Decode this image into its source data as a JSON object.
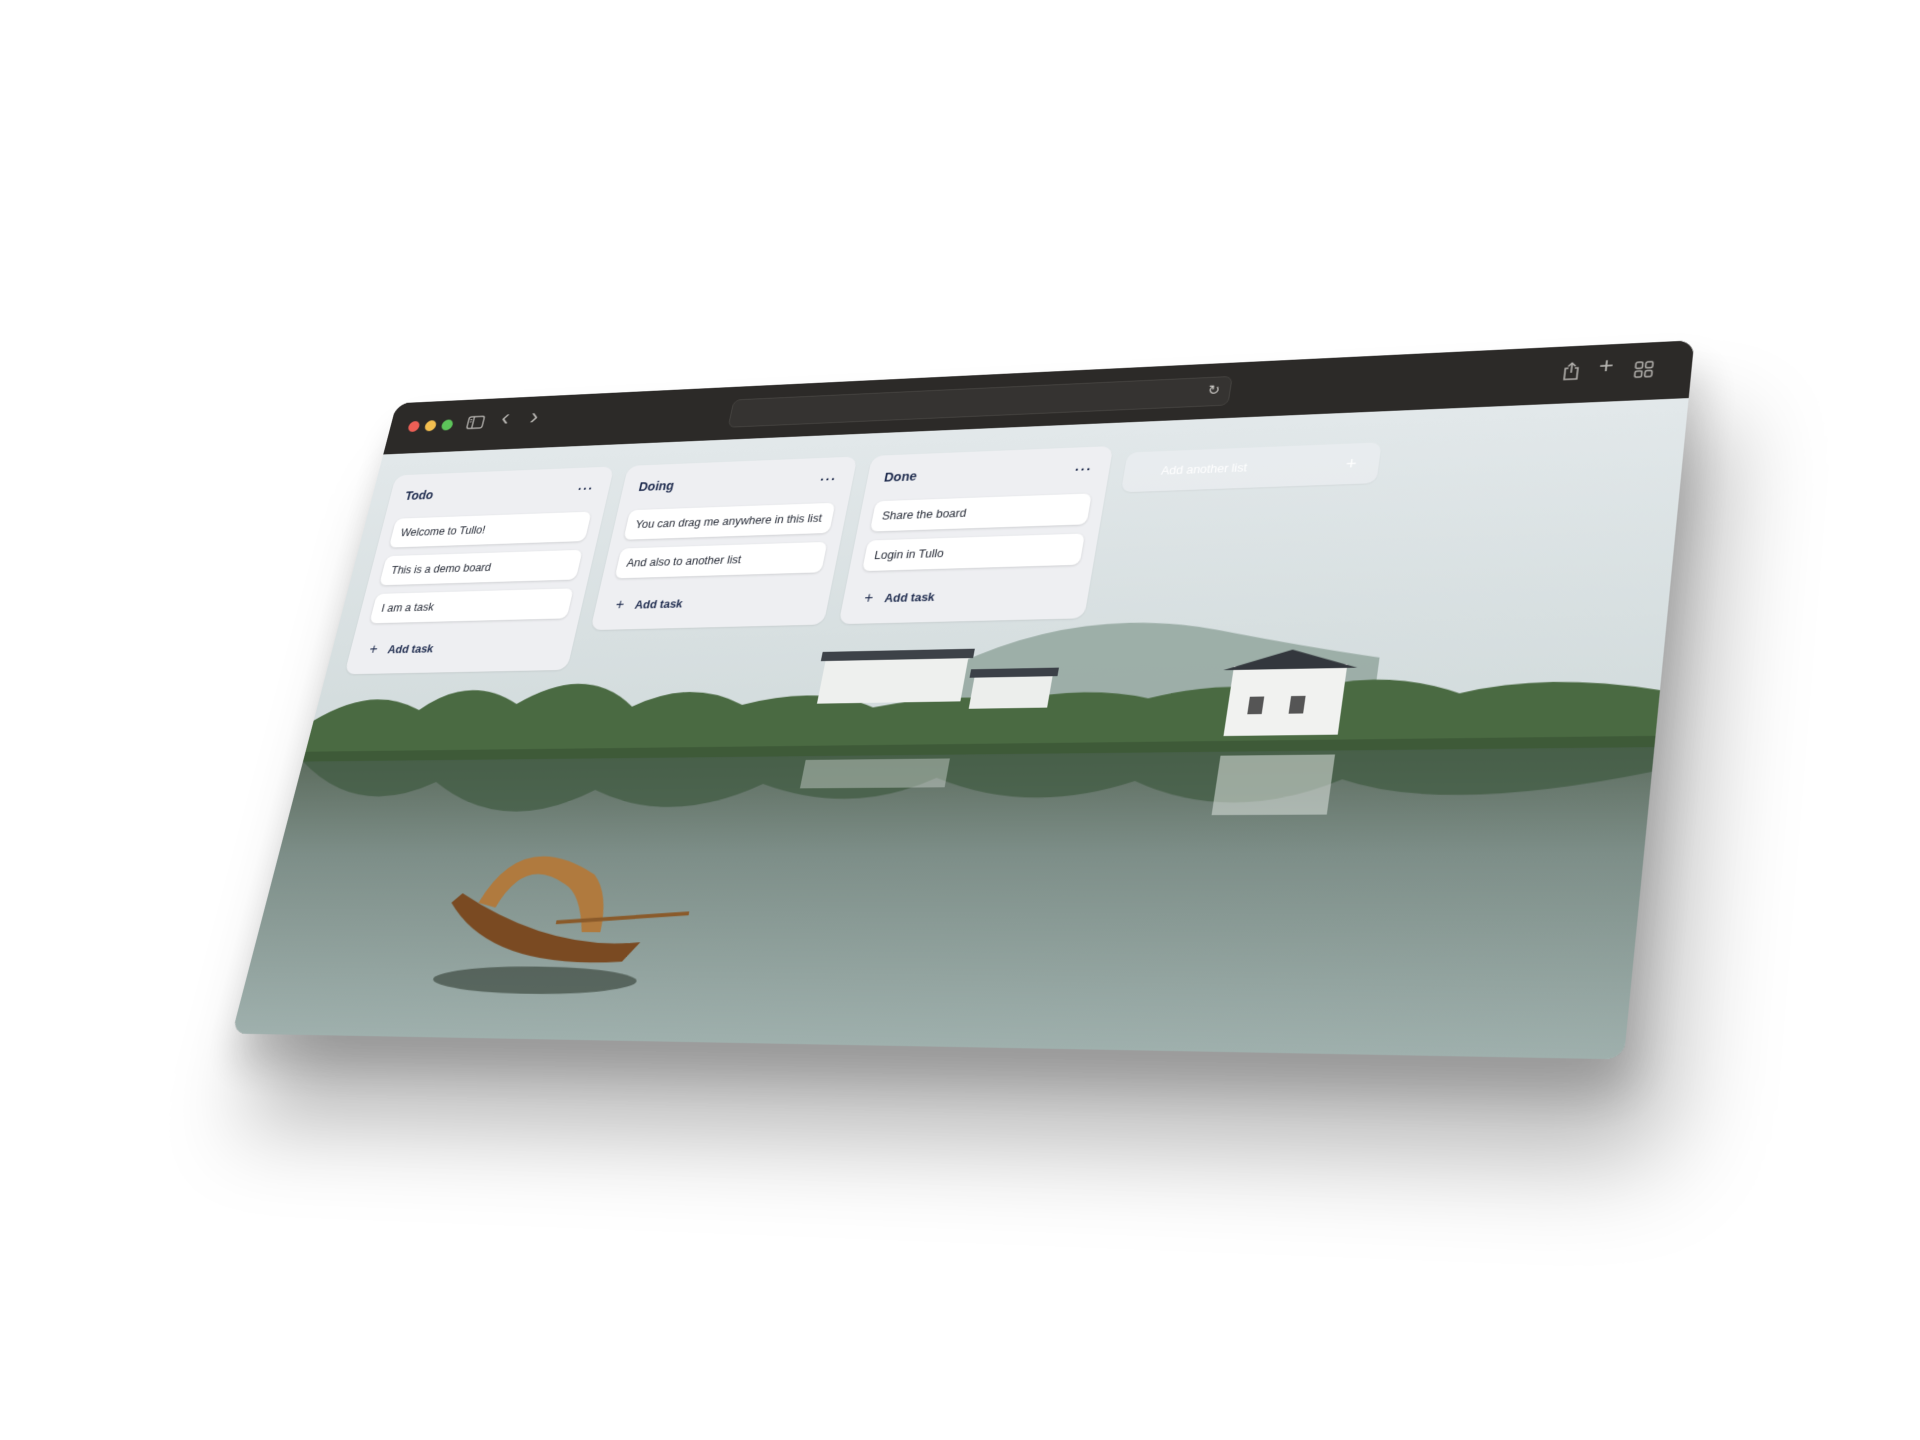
{
  "browser": {
    "address": "",
    "icons": {
      "sidebar": "sidebar-icon",
      "back": "chevron-left-icon",
      "forward": "chevron-right-icon",
      "reload": "reload-icon",
      "share": "share-icon",
      "new_tab": "plus-icon",
      "tabs": "tab-overview-icon"
    },
    "glyphs": {
      "back": "‹",
      "forward": "›",
      "reload": "↻",
      "new_tab": "+"
    }
  },
  "board": {
    "lists": [
      {
        "title": "Todo",
        "menu": "···",
        "cards": [
          "Welcome to Tullo!",
          "This is a demo board",
          "I am a task"
        ],
        "add_task": "Add task"
      },
      {
        "title": "Doing",
        "menu": "···",
        "cards": [
          "You can drag me anywhere in this list",
          "And also to another list"
        ],
        "add_task": "Add task"
      },
      {
        "title": "Done",
        "menu": "···",
        "cards": [
          "Share the board",
          "Login in Tullo"
        ],
        "add_task": "Add task"
      }
    ],
    "add_list": {
      "label": "Add another list",
      "plus": "+"
    },
    "plus_glyph": "+"
  },
  "colors": {
    "titlebar": "#2c2a28",
    "list_bg": "#eeeff2",
    "list_title": "#1d2a4d",
    "traffic_red": "#ec5f56",
    "traffic_yellow": "#f3be4f",
    "traffic_green": "#5dc45a"
  }
}
